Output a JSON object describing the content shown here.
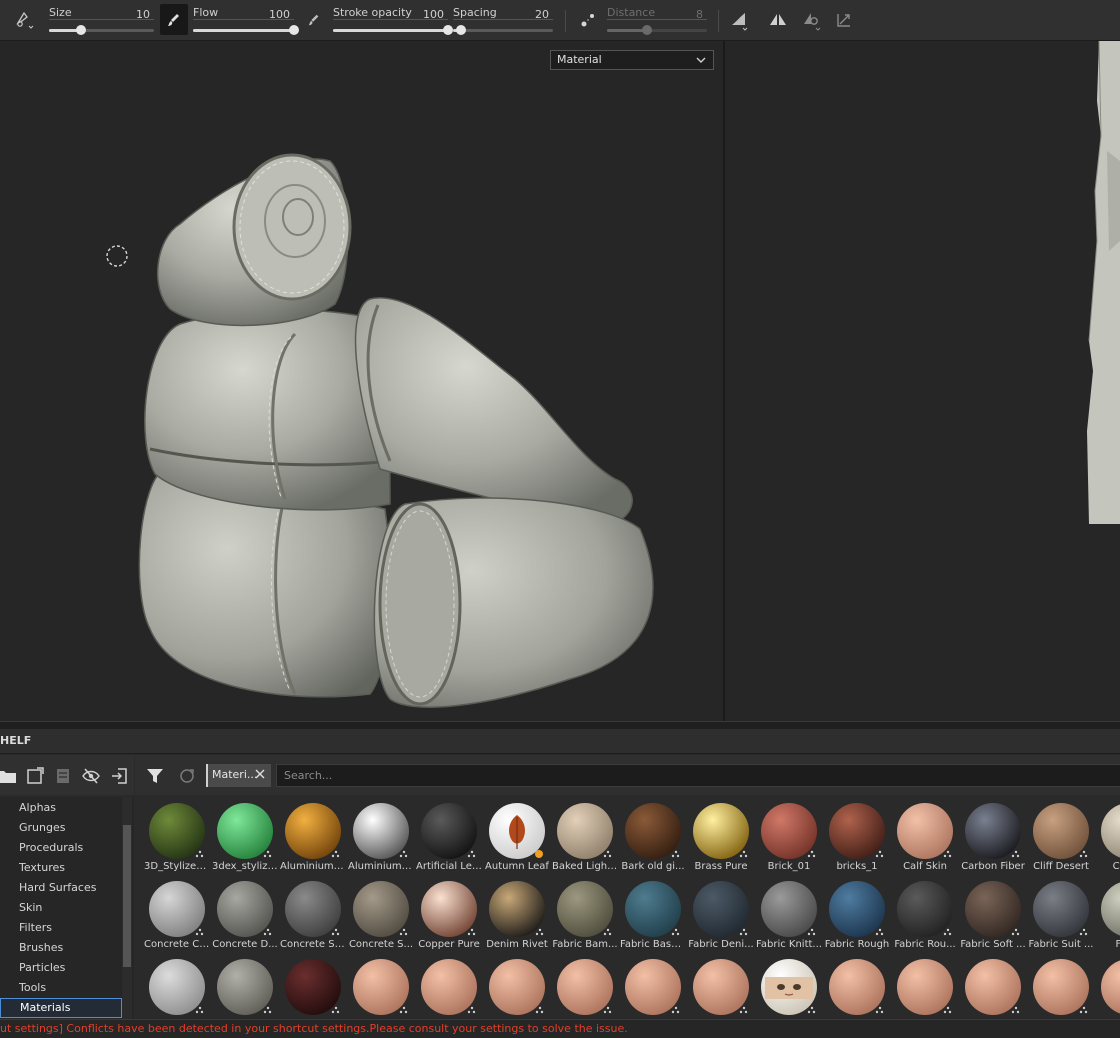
{
  "toolbar": {
    "sliders": [
      {
        "label": "Size",
        "value": "10",
        "fraction": 0.3
      },
      {
        "label": "Flow",
        "value": "100",
        "fraction": 1.0
      },
      {
        "label": "Stroke opacity",
        "value": "100",
        "fraction": 1.0
      },
      {
        "label": "Spacing",
        "value": "20",
        "fraction": 0.08
      },
      {
        "label": "Distance",
        "value": "8",
        "fraction": 0.4,
        "disabled": true
      }
    ],
    "icons": [
      "brush-preset-icon",
      "tool-brush-icon",
      "stroke-opacity-icon",
      "lazy-mouse-icon",
      "angle-icon",
      "symmetry-icon",
      "physics-icon",
      "transform-icon"
    ]
  },
  "viewport": {
    "channel_select": "Material"
  },
  "shelf": {
    "title": "HELF",
    "categories": [
      "Alphas",
      "Grunges",
      "Procedurals",
      "Textures",
      "Hard Surfaces",
      "Skin",
      "Filters",
      "Brushes",
      "Particles",
      "Tools",
      "Materials"
    ],
    "active_category": "Materials",
    "filter_tag": "Materi...",
    "search_placeholder": "Search...",
    "materials": [
      {
        "name": "3D_Stylized...",
        "c1": "#6f8a3a",
        "c2": "#1f2e12"
      },
      {
        "name": "3dex_stylize...",
        "c1": "#7fe89a",
        "c2": "#1f7a35"
      },
      {
        "name": "Aluminium ...",
        "c1": "#f2b040",
        "c2": "#6a3c08"
      },
      {
        "name": "Aluminium ...",
        "c1": "#ffffff",
        "c2": "#4a4a4a"
      },
      {
        "name": "Artificial Lea...",
        "c1": "#5a5a5a",
        "c2": "#0e0e0e"
      },
      {
        "name": "Autumn Leaf",
        "c1": "#ffffff",
        "c2": "#c8c8c8",
        "leaf": true
      },
      {
        "name": "Baked Light...",
        "c1": "#e2d0b8",
        "c2": "#8a7a66"
      },
      {
        "name": "Bark old gi...",
        "c1": "#8a5a38",
        "c2": "#2e1a0e"
      },
      {
        "name": "Brass Pure",
        "c1": "#fff0a0",
        "c2": "#7a5a08"
      },
      {
        "name": "Brick_01",
        "c1": "#d07868",
        "c2": "#6e2e24"
      },
      {
        "name": "bricks_1",
        "c1": "#b0624c",
        "c2": "#3a1a14"
      },
      {
        "name": "Calf Skin",
        "c1": "#f2c0a8",
        "c2": "#a8705a"
      },
      {
        "name": "Carbon Fiber",
        "c1": "#7a8090",
        "c2": "#141418"
      },
      {
        "name": "Cliff Desert",
        "c1": "#c8a080",
        "c2": "#6a4c36"
      },
      {
        "name": "Coat...",
        "c1": "#e6dccc",
        "c2": "#8a8070"
      },
      {
        "name": "Concrete Cl...",
        "c1": "#d6d6d6",
        "c2": "#7a7a7a"
      },
      {
        "name": "Concrete D...",
        "c1": "#a8a8a2",
        "c2": "#4e4e4a"
      },
      {
        "name": "Concrete Si...",
        "c1": "#8a8a8a",
        "c2": "#3a3a3a"
      },
      {
        "name": "Concrete S...",
        "c1": "#a49a8a",
        "c2": "#4c463c"
      },
      {
        "name": "Copper Pure",
        "c1": "#fae0d0",
        "c2": "#6a3a2a"
      },
      {
        "name": "Denim Rivet",
        "c1": "#c8a878",
        "c2": "#121212"
      },
      {
        "name": "Fabric Bam...",
        "c1": "#9c9880",
        "c2": "#4a4838"
      },
      {
        "name": "Fabric Base...",
        "c1": "#4e7c8e",
        "c2": "#1e3a46"
      },
      {
        "name": "Fabric Deni...",
        "c1": "#4c5a66",
        "c2": "#1e262e"
      },
      {
        "name": "Fabric Knitt...",
        "c1": "#9a9a9a",
        "c2": "#444444"
      },
      {
        "name": "Fabric Rough",
        "c1": "#4e7ca0",
        "c2": "#1a3048"
      },
      {
        "name": "Fabric Rou...",
        "c1": "#5a5a5a",
        "c2": "#1e1e1e"
      },
      {
        "name": "Fabric Soft ...",
        "c1": "#7a6458",
        "c2": "#2e241e"
      },
      {
        "name": "Fabric Suit ...",
        "c1": "#7a7e86",
        "c2": "#2e3036"
      },
      {
        "name": "Foo...",
        "c1": "#d0d0c0",
        "c2": "#6a6a60"
      },
      {
        "name": "",
        "c1": "#dcdcdc",
        "c2": "#8a8a8a"
      },
      {
        "name": "",
        "c1": "#b0b0a8",
        "c2": "#5a5a52"
      },
      {
        "name": "",
        "c1": "#6a2e2e",
        "c2": "#1e0a0a"
      },
      {
        "name": "",
        "c1": "#f2c0a6",
        "c2": "#a86e58"
      },
      {
        "name": "",
        "c1": "#f2c0a6",
        "c2": "#a86e58"
      },
      {
        "name": "",
        "c1": "#f2c0a6",
        "c2": "#a86e58"
      },
      {
        "name": "",
        "c1": "#f2c0a6",
        "c2": "#a86e58"
      },
      {
        "name": "",
        "c1": "#f2c0a6",
        "c2": "#a86e58"
      },
      {
        "name": "",
        "c1": "#f2c0a6",
        "c2": "#a86e58"
      },
      {
        "name": "",
        "c1": "#ffffff",
        "c2": "#c8c0b0",
        "face": true
      },
      {
        "name": "",
        "c1": "#f2c0a6",
        "c2": "#a86e58"
      },
      {
        "name": "",
        "c1": "#f2c0a6",
        "c2": "#a86e58"
      },
      {
        "name": "",
        "c1": "#f2c0a6",
        "c2": "#a86e58"
      },
      {
        "name": "",
        "c1": "#f2c0a6",
        "c2": "#a86e58"
      },
      {
        "name": "",
        "c1": "#f2c0a6",
        "c2": "#a86e58"
      }
    ]
  },
  "status": {
    "message": "ut settings] Conflicts have been detected in your shortcut settings.Please consult your settings to solve the issue."
  },
  "colors": {
    "accent": "#4d8fd8",
    "error_text": "#e0402a",
    "model_clay": "#b4b6ae"
  }
}
